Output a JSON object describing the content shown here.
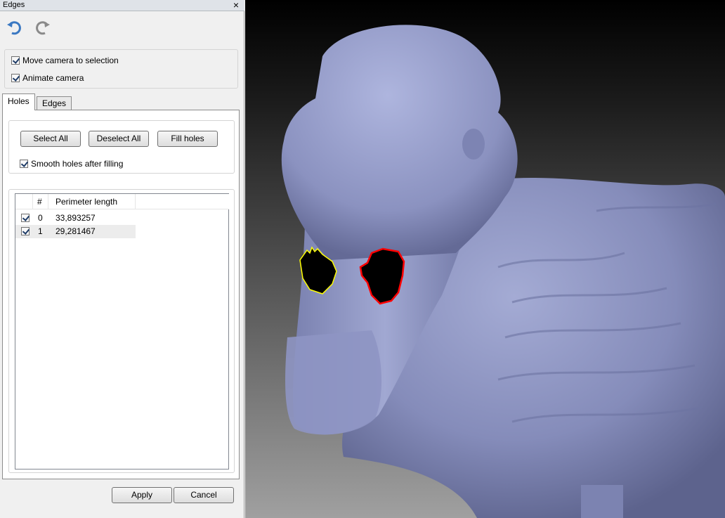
{
  "window": {
    "title": "Edges"
  },
  "toolbar": {
    "undo_icon": "undo-icon",
    "redo_icon": "redo-icon"
  },
  "camera": {
    "move_label": "Move camera to selection",
    "move_checked": true,
    "animate_label": "Animate camera",
    "animate_checked": true
  },
  "tabs": [
    {
      "label": "Holes",
      "active": true
    },
    {
      "label": "Edges",
      "active": false
    }
  ],
  "holes": {
    "select_all_label": "Select All",
    "deselect_all_label": "Deselect All",
    "fill_holes_label": "Fill holes",
    "smooth_label": "Smooth holes after filling",
    "smooth_checked": true
  },
  "table": {
    "columns": [
      "#",
      "Perimeter length"
    ],
    "rows": [
      {
        "checked": true,
        "index": "0",
        "perimeter": "33,893257"
      },
      {
        "checked": true,
        "index": "1",
        "perimeter": "29,281467"
      }
    ]
  },
  "footer": {
    "apply_label": "Apply",
    "cancel_label": "Cancel"
  },
  "colors": {
    "mesh": "#8f96c2",
    "hole_selected_outline": "#ffff00",
    "hole_outline": "#ff0000",
    "hole_fill": "#000000"
  }
}
